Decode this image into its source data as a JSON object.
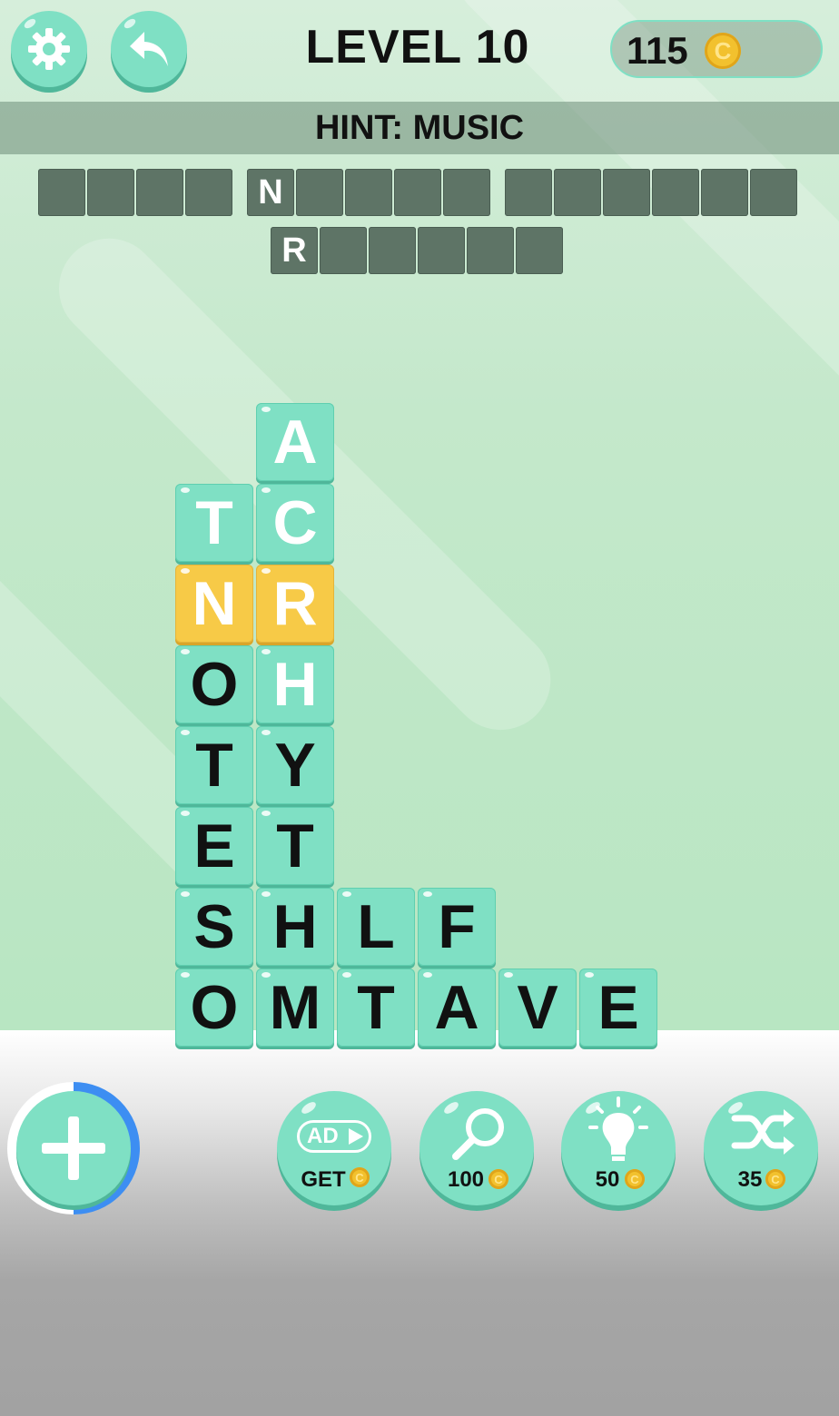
{
  "header": {
    "level_title": "LEVEL 10",
    "coins": "115",
    "coin_symbol": "C"
  },
  "hint": {
    "text": "HINT: MUSIC"
  },
  "answer_slots": {
    "row1": [
      {
        "letter": ""
      },
      {
        "letter": ""
      },
      {
        "letter": ""
      },
      {
        "letter": ""
      },
      {
        "letter": "N"
      },
      {
        "letter": ""
      },
      {
        "letter": ""
      },
      {
        "letter": ""
      },
      {
        "letter": ""
      },
      {
        "letter": ""
      },
      {
        "letter": ""
      },
      {
        "letter": ""
      },
      {
        "letter": ""
      },
      {
        "letter": ""
      },
      {
        "letter": ""
      }
    ],
    "row2": [
      {
        "letter": "R"
      },
      {
        "letter": ""
      },
      {
        "letter": ""
      },
      {
        "letter": ""
      },
      {
        "letter": ""
      },
      {
        "letter": ""
      }
    ]
  },
  "board": {
    "tiles": [
      {
        "letter": "A",
        "style": "white"
      },
      {
        "letter": "T",
        "style": "white"
      },
      {
        "letter": "C",
        "style": "white"
      },
      {
        "letter": "N",
        "style": "gold"
      },
      {
        "letter": "R",
        "style": "gold"
      },
      {
        "letter": "O",
        "style": "black"
      },
      {
        "letter": "H",
        "style": "white"
      },
      {
        "letter": "T",
        "style": "black"
      },
      {
        "letter": "Y",
        "style": "black"
      },
      {
        "letter": "E",
        "style": "black"
      },
      {
        "letter": "T",
        "style": "black"
      },
      {
        "letter": "S",
        "style": "black"
      },
      {
        "letter": "H",
        "style": "black"
      },
      {
        "letter": "L",
        "style": "black"
      },
      {
        "letter": "F",
        "style": "black"
      },
      {
        "letter": "O",
        "style": "black"
      },
      {
        "letter": "M",
        "style": "black"
      },
      {
        "letter": "T",
        "style": "black"
      },
      {
        "letter": "A",
        "style": "black"
      },
      {
        "letter": "V",
        "style": "black"
      },
      {
        "letter": "E",
        "style": "black"
      }
    ]
  },
  "powerups": {
    "ad_badge": "AD",
    "ad_label": "GET",
    "magnify_cost": "100",
    "bulb_cost": "50",
    "shuffle_cost": "35"
  },
  "colors": {
    "tile": "#7fe0c4",
    "tile_selected": "#f7ca47",
    "slot": "#5e7466",
    "coin": "#f2c12e",
    "progress_ring": "#3d8ef2"
  },
  "icons": {
    "settings": "gear-icon",
    "back": "back-arrow-icon",
    "plus": "plus-icon",
    "ad": "ad-video-icon",
    "magnify": "magnifier-icon",
    "bulb": "lightbulb-icon",
    "shuffle": "shuffle-icon",
    "coin": "coin-icon"
  }
}
